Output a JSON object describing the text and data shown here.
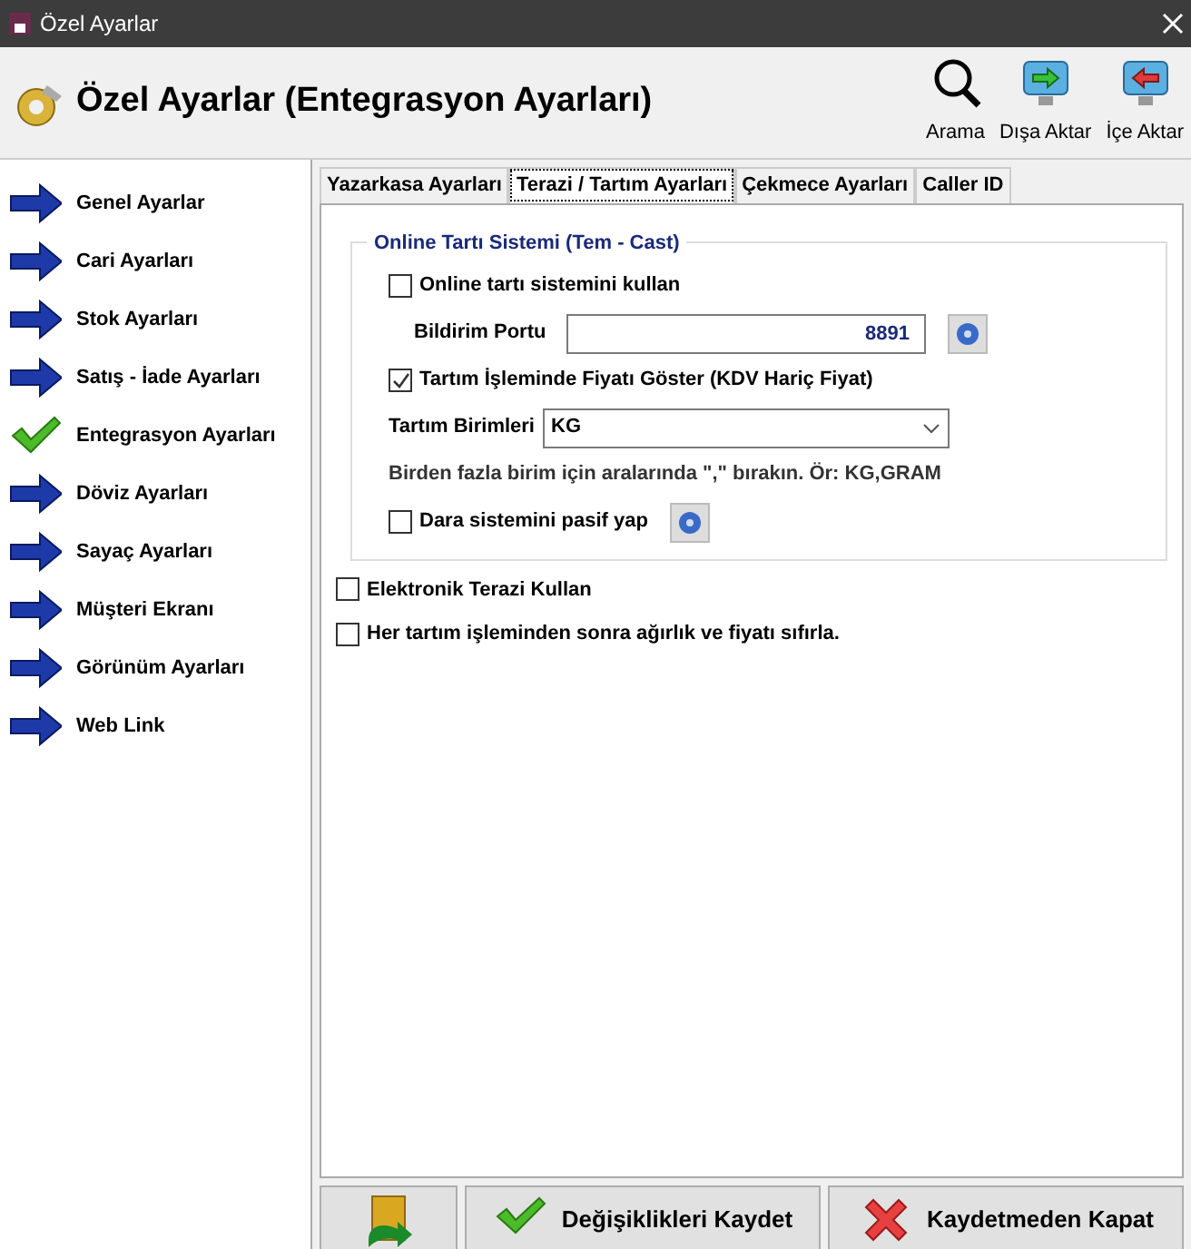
{
  "window": {
    "title": "Özel Ayarlar"
  },
  "header": {
    "title": "Özel Ayarlar (Entegrasyon Ayarları)",
    "tools": [
      {
        "kind": "search",
        "label": "Arama"
      },
      {
        "kind": "export",
        "label": "Dışa Aktar"
      },
      {
        "kind": "import",
        "label": "İçe Aktar"
      }
    ]
  },
  "sidebar": {
    "items": [
      {
        "label": "Genel Ayarlar",
        "selected": false
      },
      {
        "label": "Cari Ayarları",
        "selected": false
      },
      {
        "label": "Stok Ayarları",
        "selected": false
      },
      {
        "label": "Satış - İade Ayarları",
        "selected": false
      },
      {
        "label": "Entegrasyon Ayarları",
        "selected": true
      },
      {
        "label": "Döviz Ayarları",
        "selected": false
      },
      {
        "label": "Sayaç Ayarları",
        "selected": false
      },
      {
        "label": "Müşteri Ekranı",
        "selected": false
      },
      {
        "label": "Görünüm Ayarları",
        "selected": false
      },
      {
        "label": "Web Link",
        "selected": false
      }
    ]
  },
  "tabs": [
    {
      "label": "Yazarkasa Ayarları",
      "selected": false
    },
    {
      "label": "Terazi / Tartım Ayarları",
      "selected": true
    },
    {
      "label": "Çekmece Ayarları",
      "selected": false
    },
    {
      "label": "Caller ID",
      "selected": false
    }
  ],
  "group": {
    "title": "Online Tartı Sistemi (Tem - Cast)",
    "items": [
      {
        "kind": "checkbox",
        "label": "Online tartı sistemini kullan",
        "checked": false
      },
      {
        "kind": "number",
        "label": "Bildirim Portu",
        "value": "8891",
        "help": true
      },
      {
        "kind": "checkbox",
        "label": "Tartım İşleminde Fiyatı Göster (KDV Hariç Fiyat)",
        "checked": true
      },
      {
        "kind": "select",
        "label": "Tartım Birimleri",
        "value": "KG"
      },
      {
        "kind": "note",
        "label": "Birden fazla birim için aralarında \",\" bırakın. Ör: KG,GRAM"
      },
      {
        "kind": "checkbox",
        "label": "Dara sistemini pasif yap",
        "checked": false,
        "help": true
      }
    ]
  },
  "options": [
    {
      "label": "Elektronik Terazi Kullan",
      "checked": false
    },
    {
      "label": "Her tartım işleminden sonra ağırlık ve fiyatı sıfırla.",
      "checked": false
    }
  ],
  "footer": {
    "buttons": [
      {
        "kind": "exit"
      },
      {
        "kind": "save",
        "label": "Değişiklikleri Kaydet"
      },
      {
        "kind": "cancel",
        "label": "Kaydetmeden Kapat"
      }
    ]
  }
}
